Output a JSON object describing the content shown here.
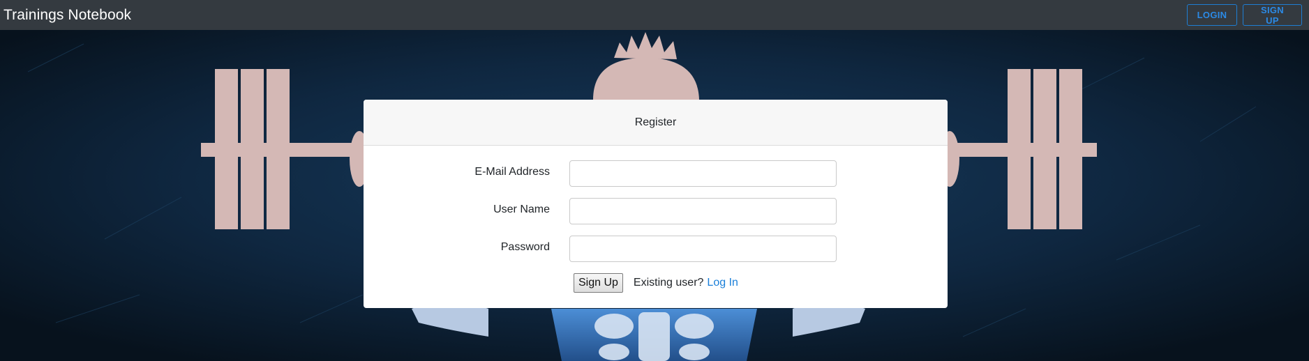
{
  "navbar": {
    "brand": "Trainings Notebook",
    "login_label": "LOGIN",
    "signup_label": "SIGN UP",
    "accent_color": "#2b8ae6",
    "background_color": "#343a40"
  },
  "card": {
    "title": "Register",
    "fields": {
      "email": {
        "label": "E-Mail Address",
        "value": "",
        "type": "email"
      },
      "username": {
        "label": "User Name",
        "value": "",
        "type": "text"
      },
      "password": {
        "label": "Password",
        "value": "",
        "type": "password"
      }
    },
    "submit_label": "Sign Up",
    "existing_text": "Existing user?",
    "login_link": "Log In"
  },
  "background": {
    "description_icon": "weightlifter-icon",
    "base_color": "#0d1d2e",
    "figure_color": "#d4b8b5",
    "body_color": "#2e6ab0"
  }
}
